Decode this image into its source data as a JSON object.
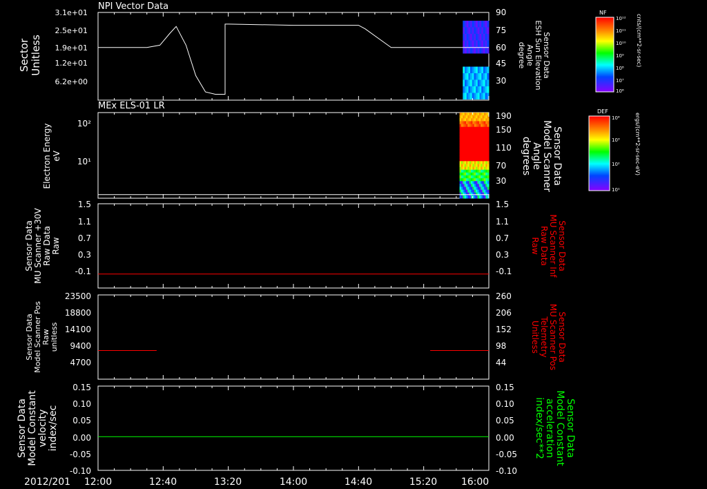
{
  "date_label": "2012/201",
  "x_ticks": [
    "12:00",
    "12:40",
    "13:20",
    "14:00",
    "14:40",
    "15:20",
    "16:00"
  ],
  "colors": {
    "background": "#000000",
    "foreground": "#ffffff",
    "red": "#ff0000",
    "green": "#00ff00"
  },
  "colorbars": [
    {
      "title": "NF",
      "unit": "cnts/(cm**2-sr-sec)",
      "ticks": [
        "10¹²",
        "10¹¹",
        "10¹⁰",
        "10⁹",
        "10⁸",
        "10⁷",
        "10⁶"
      ]
    },
    {
      "title": "DEF",
      "unit": "ergs/(cm**2-sr-sec-eV)",
      "ticks": [
        "10⁴",
        "10³",
        "10²",
        "10¹"
      ]
    }
  ],
  "chart_data": [
    {
      "type": "line",
      "title": "NPI Vector Data",
      "ylabel_left": [
        "Sector",
        "Unitless"
      ],
      "yticks_left": [
        "3.1e+01",
        "2.5e+01",
        "1.9e+01",
        "1.2e+01",
        "6.2e+00"
      ],
      "ylabel_right": [
        "Sensor Data",
        "ESH Sun Elevation",
        "Angle",
        "degree"
      ],
      "yticks_right": [
        "90",
        "75",
        "60",
        "45",
        "30"
      ],
      "xlim": [
        0,
        240
      ],
      "ylim_right": [
        15,
        90
      ],
      "series": [
        {
          "axis": "right",
          "color": "#ffffff",
          "points": [
            [
              0,
              60
            ],
            [
              30,
              60
            ],
            [
              38,
              62
            ],
            [
              44,
              72
            ],
            [
              48,
              78
            ],
            [
              54,
              62
            ],
            [
              60,
              36
            ],
            [
              66,
              22
            ],
            [
              72,
              20
            ],
            [
              78,
              20
            ],
            [
              78,
              80
            ],
            [
              80,
              80
            ],
            [
              120,
              79
            ],
            [
              160,
              79
            ],
            [
              164,
              76
            ],
            [
              176,
              64
            ],
            [
              180,
              60
            ],
            [
              240,
              60
            ]
          ]
        }
      ],
      "spectrogram": {
        "x_start": 224,
        "x_end": 240,
        "colorbar": "NF"
      }
    },
    {
      "type": "heatmap",
      "title": "MEx ELS-01 LR",
      "ylabel_left": [
        "Electron Energy",
        "eV"
      ],
      "yticks_left": [
        "10²",
        "10¹"
      ],
      "ylabel_right": [
        "Sensor Data",
        "Model Scanner",
        "Angle",
        "degrees"
      ],
      "yticks_right": [
        "190",
        "150",
        "110",
        "70",
        "30"
      ],
      "xlim": [
        0,
        240
      ],
      "ylim_right": [
        0,
        190
      ],
      "series": [
        {
          "axis": "right",
          "color": "#ffffff",
          "points": [
            [
              0,
              8
            ],
            [
              240,
              8
            ]
          ]
        }
      ],
      "spectrogram": {
        "x_start": 222,
        "x_end": 240,
        "colorbar": "DEF"
      }
    },
    {
      "type": "line",
      "ylabel_left": [
        "Sensor Data",
        "MU Scanner +30V",
        "Raw Data",
        "Raw"
      ],
      "yticks_left": [
        "1.5",
        "1.1",
        "0.7",
        "0.3",
        "-0.1"
      ],
      "ylabel_right": [
        "Sensor Data",
        "MU Scanner Inf",
        "Raw Data",
        "Raw"
      ],
      "yticks_right": [
        "1.5",
        "1.1",
        "0.7",
        "0.3",
        "-0.1"
      ],
      "xlim": [
        0,
        240
      ],
      "ylim": [
        -0.3,
        1.5
      ],
      "series": [
        {
          "axis": "left",
          "color": "#ff0000",
          "points": [
            [
              0,
              0
            ],
            [
              240,
              0
            ]
          ]
        }
      ]
    },
    {
      "type": "line",
      "ylabel_left": [
        "Sensor Data",
        "Model Scanner Pos",
        "Raw",
        "unitless"
      ],
      "yticks_left": [
        "23500",
        "18800",
        "14100",
        "9400",
        "4700"
      ],
      "ylabel_right": [
        "Sensor Data",
        "MU Scanner Pos",
        "Telemetry",
        "Unitless"
      ],
      "yticks_right": [
        "260",
        "206",
        "152",
        "98",
        "44"
      ],
      "xlim": [
        0,
        240
      ],
      "ylim": [
        0,
        23500
      ],
      "series": [
        {
          "axis": "left",
          "color": "#ff0000",
          "points": [
            [
              0,
              8000
            ],
            [
              36,
              8000
            ]
          ]
        },
        {
          "axis": "left",
          "color": "#ff0000",
          "points": [
            [
              204,
              8000
            ],
            [
              240,
              8000
            ]
          ]
        }
      ]
    },
    {
      "type": "line",
      "ylabel_left": [
        "Sensor Data",
        "Model Constant",
        "velocity",
        "index/sec"
      ],
      "yticks_left": [
        "0.15",
        "0.10",
        "0.05",
        "0.00",
        "-0.05",
        "-0.10"
      ],
      "ylabel_right": [
        "Sensor Data",
        "Model Constant",
        "acceleration",
        "index/sec**2"
      ],
      "yticks_right": [
        "0.15",
        "0.10",
        "0.05",
        "0.00",
        "-0.05",
        "-0.10"
      ],
      "xlim": [
        0,
        240
      ],
      "ylim": [
        -0.1,
        0.15
      ],
      "series": [
        {
          "axis": "left",
          "color": "#00ff00",
          "points": [
            [
              0,
              0
            ],
            [
              240,
              0
            ]
          ]
        }
      ]
    }
  ]
}
